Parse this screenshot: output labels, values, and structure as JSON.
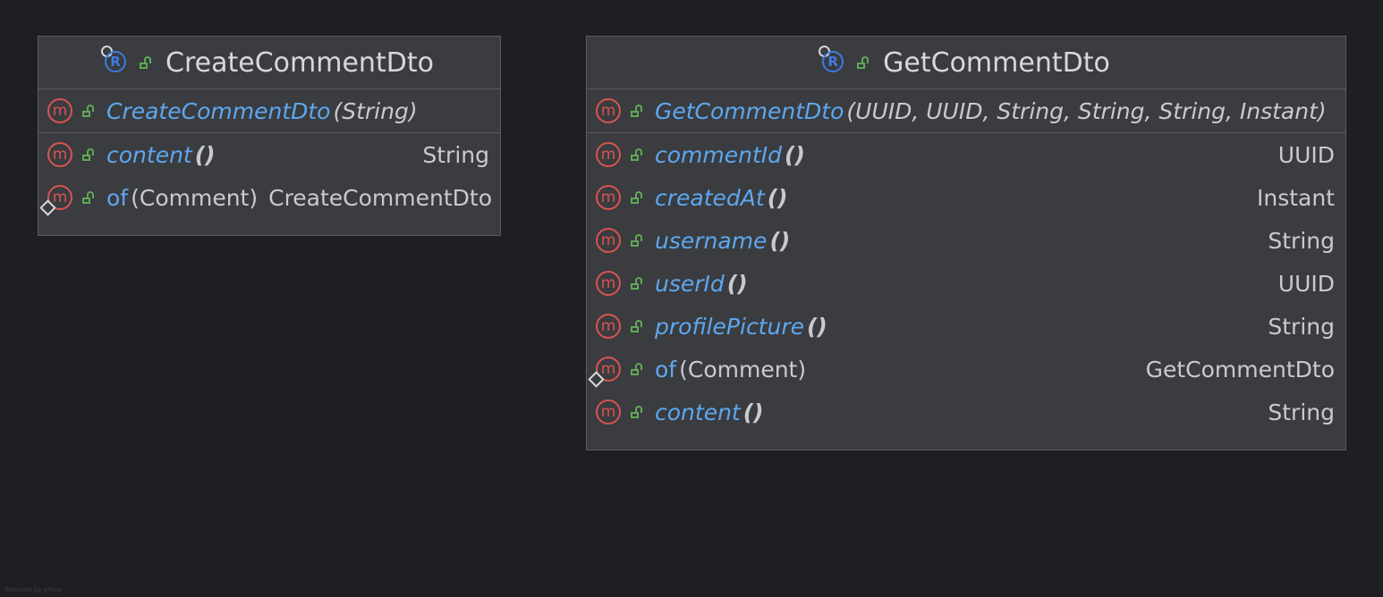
{
  "classes": [
    {
      "name": "CreateCommentDto",
      "constructor": {
        "name": "CreateCommentDto",
        "params": "(String)"
      },
      "methods": [
        {
          "name": "content",
          "params": "()",
          "type": "String",
          "static": false
        },
        {
          "name": "of",
          "params": "(Comment)",
          "type": "CreateCommentDto",
          "static": true
        }
      ]
    },
    {
      "name": "GetCommentDto",
      "constructor": {
        "name": "GetCommentDto",
        "params": "(UUID, UUID, String, String, String, Instant)"
      },
      "methods": [
        {
          "name": "commentId",
          "params": "()",
          "type": "UUID",
          "static": false
        },
        {
          "name": "createdAt",
          "params": "()",
          "type": "Instant",
          "static": false
        },
        {
          "name": "username",
          "params": "()",
          "type": "String",
          "static": false
        },
        {
          "name": "userId",
          "params": "()",
          "type": "UUID",
          "static": false
        },
        {
          "name": "profilePicture",
          "params": "()",
          "type": "String",
          "static": false
        },
        {
          "name": "of",
          "params": "(Comment)",
          "type": "GetCommentDto",
          "static": true
        },
        {
          "name": "content",
          "params": "()",
          "type": "String",
          "static": false
        }
      ]
    }
  ],
  "icons": {
    "record": "record-icon",
    "method": "method-icon",
    "public": "unlocked-icon",
    "static": "static-diamond-icon"
  },
  "colors": {
    "background": "#1e1f22",
    "box": "#3a3c40",
    "method_name": "#5ea7ef",
    "method_icon": "#d9534f",
    "visibility": "#5faa55",
    "record_icon": "#3d7be0"
  },
  "footer": "Powered by yFiles"
}
